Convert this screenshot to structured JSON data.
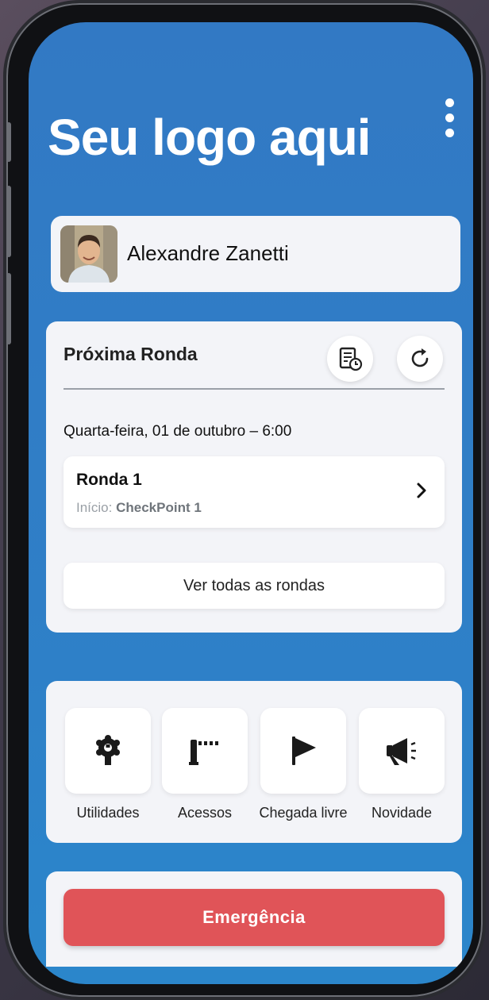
{
  "header": {
    "logo_text": "Seu logo aqui",
    "menu_icon": "kebab-menu-icon"
  },
  "user": {
    "name": "Alexandre Zanetti",
    "avatar_icon": "user-photo"
  },
  "next_round": {
    "title": "Próxima Ronda",
    "actions": [
      {
        "icon": "schedule-document-icon"
      },
      {
        "icon": "refresh-icon"
      }
    ],
    "date": "Quarta-feira, 01 de outubro – 6:00",
    "item": {
      "name": "Ronda 1",
      "start_label": "Início:",
      "start_value": "CheckPoint 1",
      "chevron_icon": "chevron-right-icon"
    },
    "view_all_label": "Ver todas as rondas"
  },
  "shortcuts": [
    {
      "label": "Utilidades",
      "icon": "utilities-icon"
    },
    {
      "label": "Acessos",
      "icon": "barrier-gate-icon"
    },
    {
      "label": "Chegada livre",
      "icon": "flag-icon"
    },
    {
      "label": "Novidade",
      "icon": "megaphone-icon"
    }
  ],
  "emergency": {
    "label": "Emergência",
    "color": "#e05458"
  },
  "colors": {
    "background_blue": "#3279c4",
    "card": "#f3f4f8",
    "emergency": "#e05458"
  }
}
